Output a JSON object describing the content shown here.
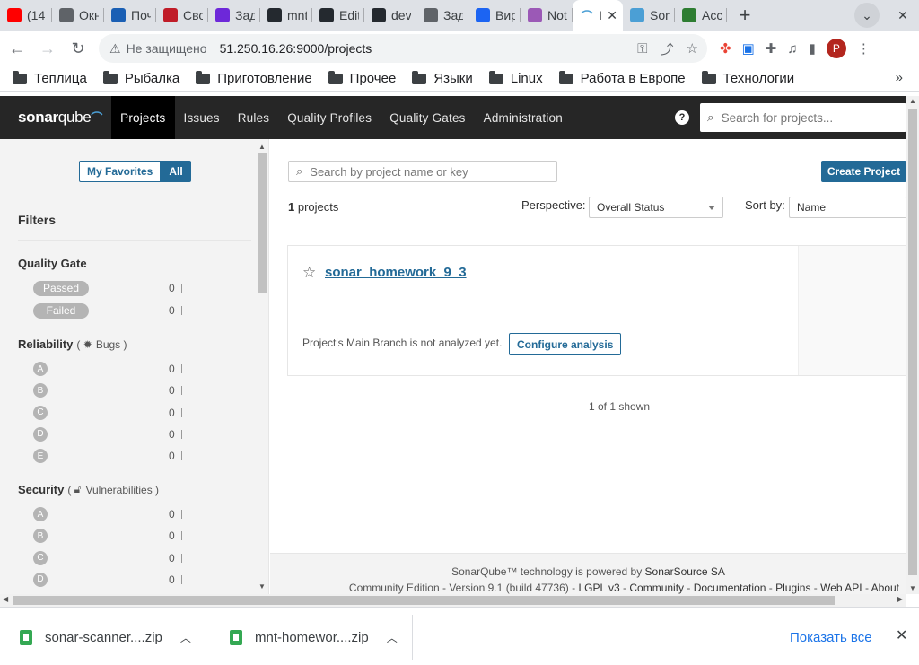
{
  "browser": {
    "tabs": [
      {
        "title": "(14",
        "favicon": "youtube-icon",
        "color": "#ff0000"
      },
      {
        "title": "Окно",
        "favicon": "globe-icon",
        "color": "#5f6368"
      },
      {
        "title": "Почта",
        "favicon": "mail-icon",
        "color": "#1a5fb4"
      },
      {
        "title": "Свод",
        "favicon": "app-icon",
        "color": "#c01c28"
      },
      {
        "title": "Задачи",
        "favicon": "slack-icon",
        "color": "#6d28d9"
      },
      {
        "title": "mnt",
        "favicon": "github-icon",
        "color": "#24292f"
      },
      {
        "title": "Edit",
        "favicon": "github-icon",
        "color": "#24292f"
      },
      {
        "title": "dev",
        "favicon": "github-icon",
        "color": "#24292f"
      },
      {
        "title": "Задачи",
        "favicon": "globe-icon",
        "color": "#5f6368"
      },
      {
        "title": "Виртуальные",
        "favicon": "yandex-cloud-icon",
        "color": "#1c64f2"
      },
      {
        "title": "Not",
        "favicon": "chrome-icon",
        "color": "#9b59b6"
      }
    ],
    "active_tab": {
      "title": "I",
      "favicon": "sonarqube-icon"
    },
    "after_tabs": [
      {
        "title": "Son",
        "favicon": "sonarqube-icon",
        "color": "#4b9fd5"
      },
      {
        "title": "Acc",
        "favicon": "cube-icon",
        "color": "#2e7d32"
      }
    ],
    "close_glyph": "✕",
    "new_tab_glyph": "+",
    "address": {
      "security_label": "Не защищено",
      "url": "51.250.16.26:9000/projects"
    },
    "profile_initial": "P",
    "bookmarks": [
      "Теплица",
      "Рыбалка",
      "Приготовление",
      "Прочее",
      "Языки",
      "Linux",
      "Работа в Европе",
      "Технологии"
    ],
    "bookmarks_more": "»"
  },
  "sonar": {
    "logo_bold": "sonar",
    "logo_light": "qube",
    "nav": [
      "Projects",
      "Issues",
      "Rules",
      "Quality Profiles",
      "Quality Gates",
      "Administration"
    ],
    "active_nav": "Projects",
    "help_glyph": "?",
    "search_placeholder": "Search for projects..."
  },
  "sidebar": {
    "favorites_label": "My Favorites",
    "all_label": "All",
    "filters_title": "Filters",
    "quality_gate": {
      "title": "Quality Gate",
      "items": [
        {
          "label": "Passed",
          "count": "0"
        },
        {
          "label": "Failed",
          "count": "0"
        }
      ]
    },
    "reliability": {
      "title": "Reliability",
      "sub": "Bugs",
      "items": [
        {
          "label": "A",
          "count": "0"
        },
        {
          "label": "B",
          "count": "0"
        },
        {
          "label": "C",
          "count": "0"
        },
        {
          "label": "D",
          "count": "0"
        },
        {
          "label": "E",
          "count": "0"
        }
      ]
    },
    "security": {
      "title": "Security",
      "sub": "Vulnerabilities",
      "items": [
        {
          "label": "A",
          "count": "0"
        },
        {
          "label": "B",
          "count": "0"
        },
        {
          "label": "C",
          "count": "0"
        },
        {
          "label": "D",
          "count": "0"
        }
      ]
    }
  },
  "main": {
    "search_placeholder": "Search by project name or key",
    "create_label": "Create Project",
    "project_count": "1",
    "projects_word": "projects",
    "perspective_label": "Perspective:",
    "perspective_value": "Overall Status",
    "sort_label": "Sort by:",
    "sort_value": "Name",
    "project": {
      "name": "sonar_homework_9_3",
      "status": "Project's Main Branch is not analyzed yet.",
      "configure_label": "Configure analysis"
    },
    "shown": "1 of 1 shown"
  },
  "footer": {
    "line1_prefix": "SonarQube™ technology is powered by",
    "line1_link": "SonarSource SA",
    "edition": "Community Edition",
    "version": "Version 9.1 (build 47736)",
    "links": [
      "LGPL v3",
      "Community",
      "Documentation",
      "Plugins",
      "Web API",
      "About"
    ]
  },
  "downloads": {
    "items": [
      "sonar-scanner....zip",
      "mnt-homewor....zip"
    ],
    "show_all": "Показать все"
  }
}
